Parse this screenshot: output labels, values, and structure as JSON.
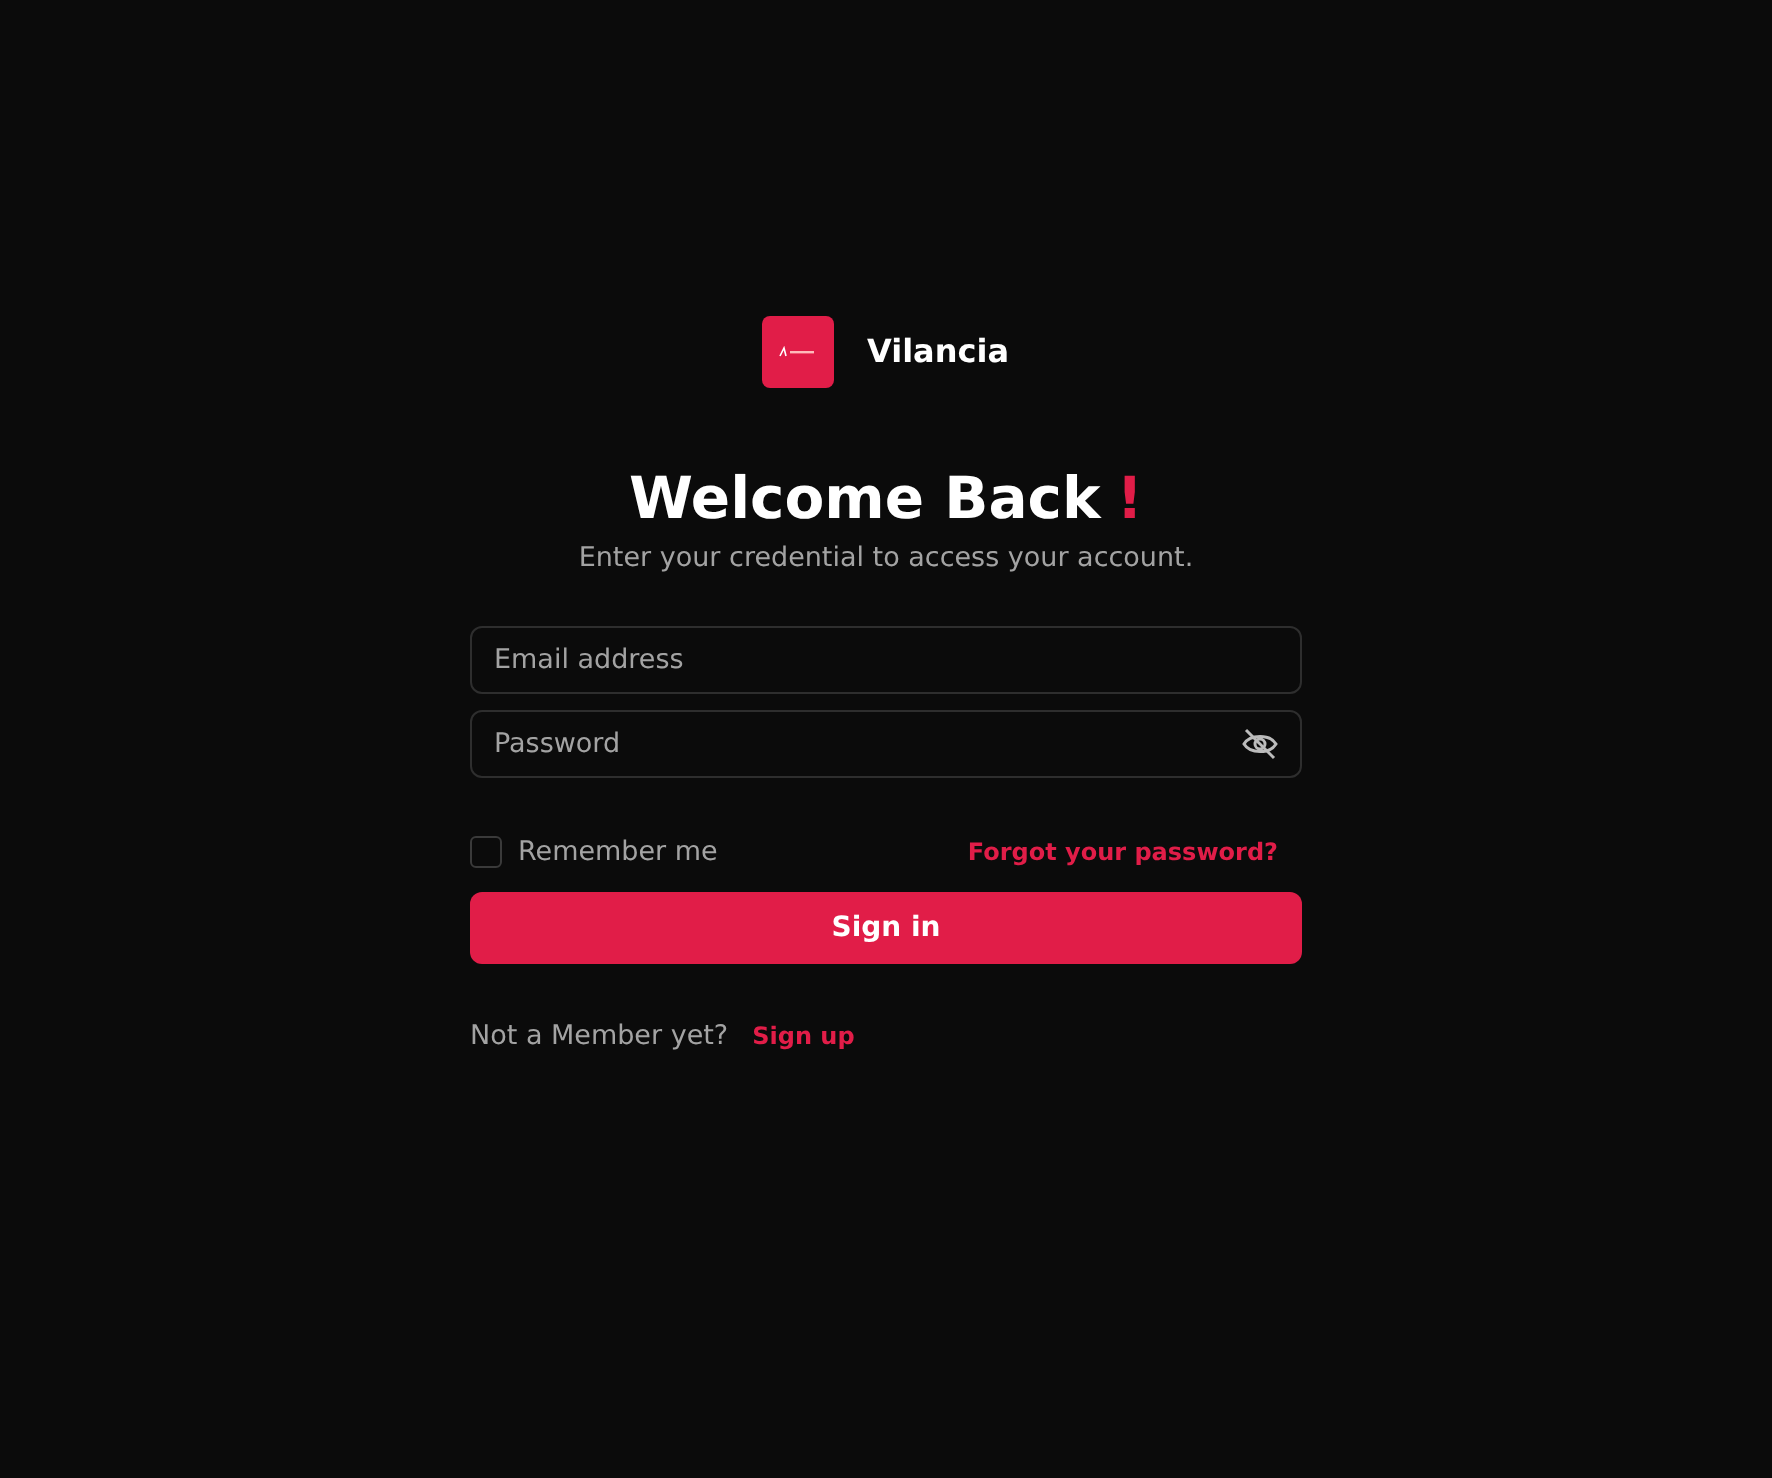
{
  "brand": {
    "name": "Vilancia"
  },
  "heading": {
    "title": "Welcome Back",
    "mark": "!",
    "subtitle": "Enter your credential to access your account."
  },
  "fields": [
    {
      "kind": "email",
      "placeholder": "Email address"
    },
    {
      "kind": "password",
      "placeholder": "Password"
    }
  ],
  "remember": {
    "label": "Remember me",
    "checked": false
  },
  "forgot_link": "Forgot your password?",
  "submit": "Sign in",
  "signup": {
    "text": "Not a Member yet?",
    "link": "Sign up"
  }
}
